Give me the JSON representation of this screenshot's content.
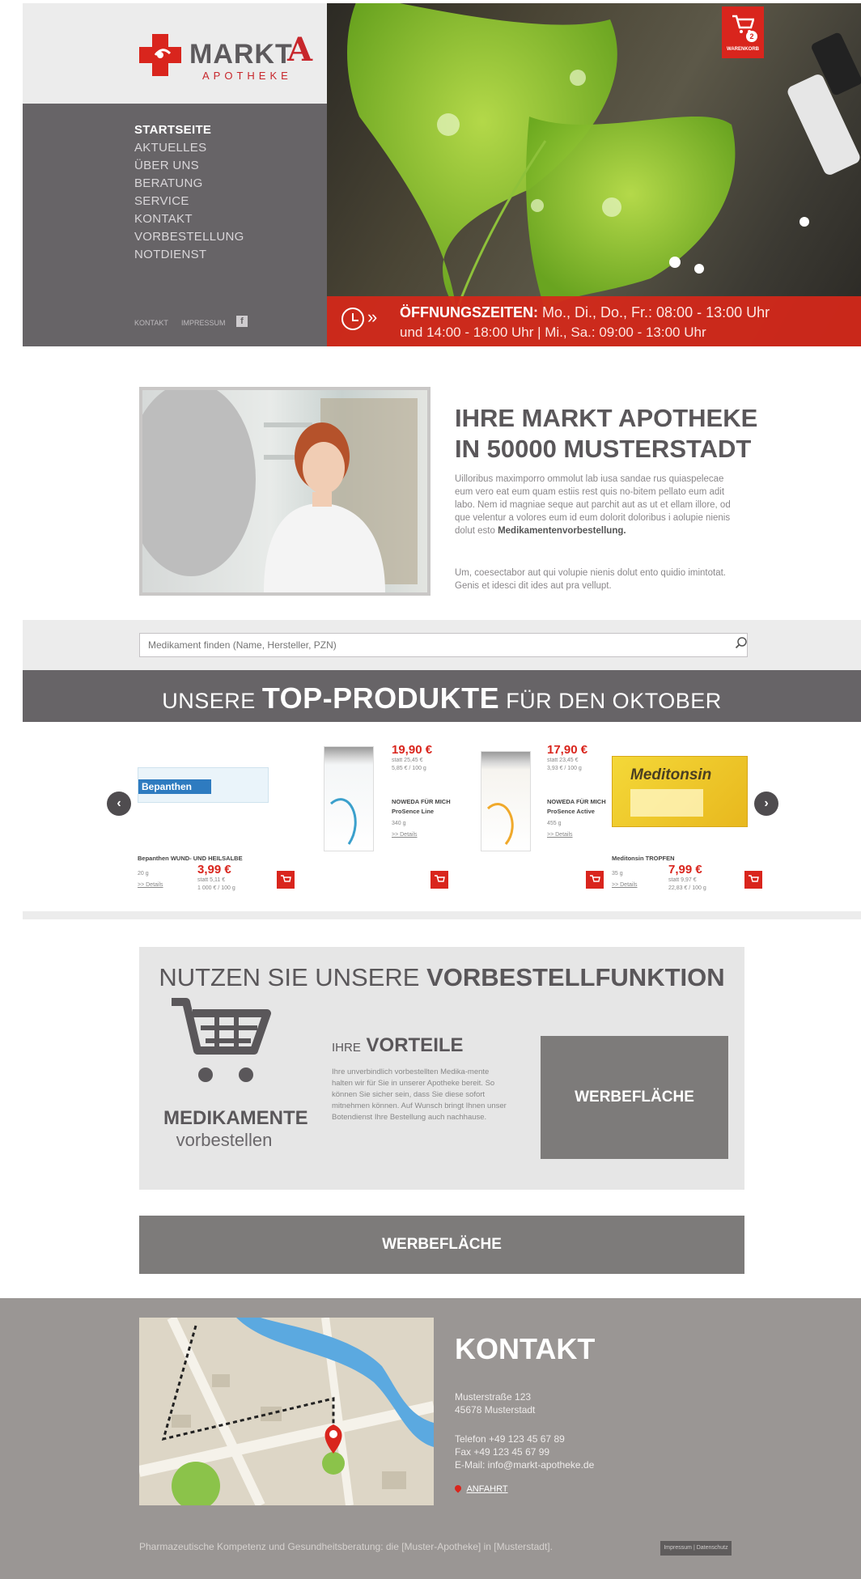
{
  "brand": {
    "name": "MARKT",
    "sub": "APOTHEKE",
    "emblem": "A"
  },
  "nav": {
    "items": [
      {
        "label": "STARTSEITE",
        "active": true
      },
      {
        "label": "AKTUELLES"
      },
      {
        "label": "ÜBER UNS"
      },
      {
        "label": "BERATUNG"
      },
      {
        "label": "SERVICE"
      },
      {
        "label": "KONTAKT"
      },
      {
        "label": "VORBESTELLUNG"
      },
      {
        "label": "NOTDIENST"
      }
    ],
    "meta": {
      "kontakt": "KONTAKT",
      "impressum": "IMPRESSUM",
      "facebook": "f"
    }
  },
  "cart": {
    "count": "2",
    "label": "WARENKORB"
  },
  "hours": {
    "label": "ÖFFNUNGSZEITEN:",
    "line1": "Mo., Di., Do., Fr.:  08:00 - 13:00 Uhr",
    "line2": "und 14:00 - 18:00 Uhr | Mi., Sa.:  09:00 - 13:00 Uhr"
  },
  "intro": {
    "title1": "IHRE MARKT APOTHEKE",
    "title2": "IN 50000  MUSTERSTADT",
    "p1": "Uilloribus maximporro ommolut lab iusa sandae rus quiaspelecae eum vero eat eum quam estiis rest quis no-bitem pellato eum adit labo. Nem id magniae seque aut parchit aut as ut et ellam illore, od que velentur a volores eum id eum dolorit doloribus i aolupie nienis dolut esto",
    "p1_bold": "Medikamentenvorbestellung.",
    "p2": "Um, coesectabor aut qui volupie nienis dolut ento quidio imintotat. Genis et idesci dit ides aut pra vellupt."
  },
  "search": {
    "placeholder": "Medikament finden (Name, Hersteller, PZN)"
  },
  "top": {
    "pre": "UNSERE",
    "bold": "TOP-PRODUKTE",
    "post": "FÜR DEN OKTOBER"
  },
  "products": [
    {
      "name": "Bepanthen WUND- UND HEILSALBE",
      "size": "20 g",
      "details": ">> Details",
      "price": "3,99 €",
      "uvp": "statt 5,11 €",
      "base": "1 000 € / 100 g",
      "pack": "Bepanthen"
    },
    {
      "name": "NOWEDA FÜR MICH",
      "name2": "ProSence Line",
      "size": "340 g",
      "details": ">> Details",
      "price": "19,90 €",
      "uvp": "statt 25,45 €",
      "base": "5,85 € / 100 g"
    },
    {
      "name": "NOWEDA FÜR MICH",
      "name2": "ProSence Active",
      "size": "455 g",
      "details": ">> Details",
      "price": "17,90 €",
      "uvp": "statt 23,45 €",
      "base": "3,93 € / 100 g"
    },
    {
      "name": "Meditonsin TROPFEN",
      "size": "35 g",
      "details": ">> Details",
      "price": "7,99 €",
      "uvp": "statt 9,97 €",
      "base": "22,83 € / 100 g",
      "pack": "Meditonsin"
    }
  ],
  "preorder": {
    "title_pre": "NUTZEN SIE UNSERE",
    "title_bold": "VORBESTELLFUNKTION",
    "medi1": "MEDIKAMENTE",
    "medi2": "vorbestellen",
    "vort_pre": "IHRE",
    "vort_bold": "VORTEILE",
    "vort_text": "Ihre unverbindlich vorbestellten Medika-mente halten wir für Sie in unserer Apotheke bereit. So können Sie sicher sein, dass Sie diese sofort mitnehmen können. Auf Wunsch bringt Ihnen unser Botendienst Ihre Bestellung auch nachhause.",
    "ad": "WERBEFLÄCHE"
  },
  "ad_wide": "WERBEFLÄCHE",
  "contact": {
    "title": "KONTAKT",
    "street": "Musterstraße 123",
    "city": "45678 Musterstadt",
    "phone": "Telefon +49 123 45 67 89",
    "fax": "Fax +49 123 45 67 99",
    "email": "E-Mail: info@markt-apotheke.de",
    "anfahrt": "ANFAHRT"
  },
  "footer": {
    "note": "Pharmazeutische Kompetenz und Gesundheitsberatung: die [Muster-Apotheke] in [Musterstadt].",
    "btn1": "Impressum",
    "btn2": "Datenschutz"
  },
  "colors": {
    "brand_red": "#d9251d",
    "nav_gray": "#676467",
    "footer_gray": "#9a9694"
  }
}
